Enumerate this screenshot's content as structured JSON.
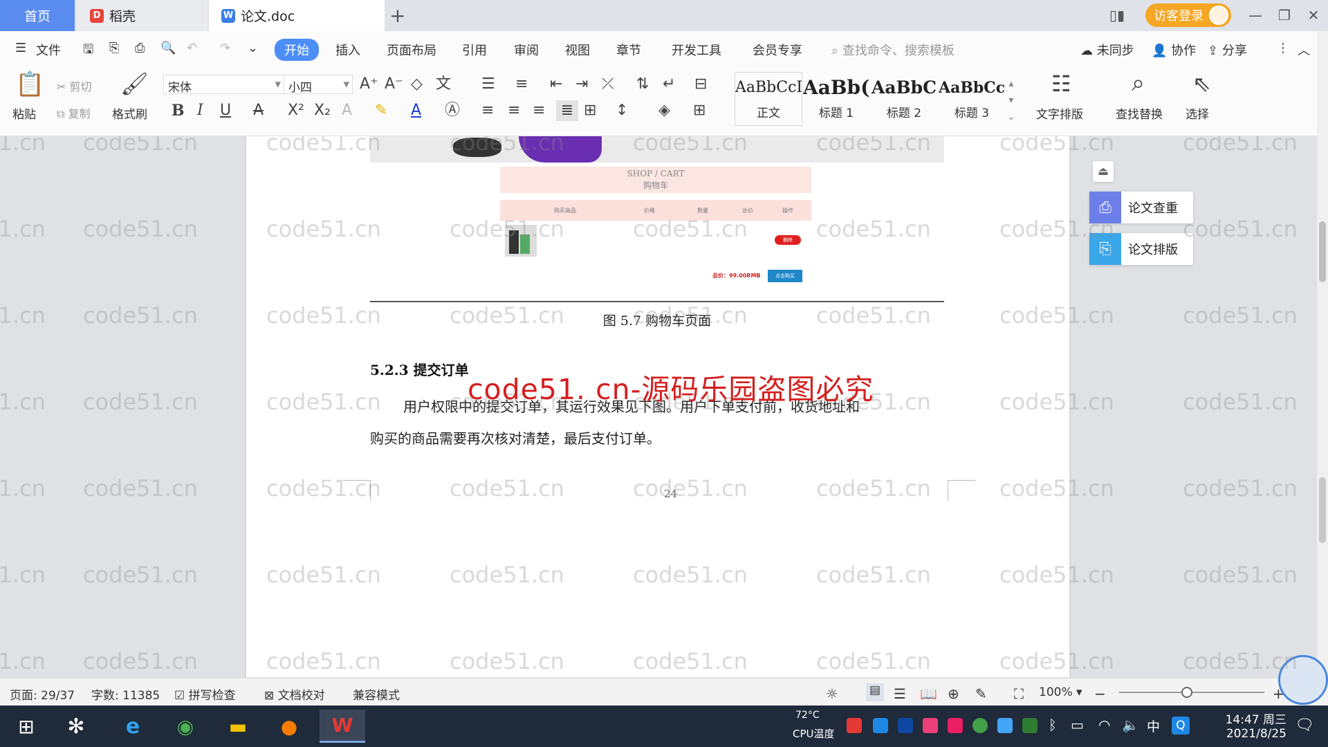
{
  "tabs": {
    "home": "首页",
    "daoke": "稻壳",
    "doc": "论文.doc"
  },
  "titlebar": {
    "visitor_login": "访客登录"
  },
  "menu": {
    "file": "文件",
    "items": [
      "开始",
      "插入",
      "页面布局",
      "引用",
      "审阅",
      "视图",
      "章节",
      "开发工具",
      "会员专享"
    ],
    "search_placeholder": "查找命令、搜索模板",
    "unsync": "未同步",
    "collab": "协作",
    "share": "分享"
  },
  "ribbon": {
    "paste": "粘贴",
    "cut": "剪切",
    "copy": "复制",
    "format_painter": "格式刷",
    "font_name": "宋体",
    "font_size": "小四",
    "styles": [
      {
        "preview": "AaBbCcI",
        "name": "正文"
      },
      {
        "preview": "AaBb(",
        "name": "标题 1"
      },
      {
        "preview": "AaBbC",
        "name": "标题 2"
      },
      {
        "preview": "AaBbCcl",
        "name": "标题 3"
      }
    ],
    "text_layout": "文字排版",
    "find_replace": "查找替换",
    "select": "选择"
  },
  "document": {
    "figure": {
      "shop_title_en": "SHOP / CART",
      "shop_title_cn": "购物车",
      "col_goods": "购买商品",
      "col_price": "价格",
      "col_qty": "数量",
      "col_total": "总价",
      "col_action": "操作",
      "delete_btn": "删除",
      "total_text": "总价：99.00RMB",
      "pay_btn": "点击购买"
    },
    "caption": "图 5.7  购物车页面",
    "heading": "5.2.3  提交订单",
    "paragraph_line1": "用户权限中的提交订单，其运行效果见下图。用户下单支付前，收货地址和",
    "paragraph_line2": "购买的商品需要再次核对清楚，最后支付订单。",
    "page_number": "24",
    "overlay_text": "code51. cn-源码乐园盗图必究"
  },
  "watermark_text": "code51.cn",
  "side_panel": {
    "check": "论文查重",
    "format": "论文排版"
  },
  "statusbar": {
    "page": "页面: 29/37",
    "words": "字数: 11385",
    "spell": "拼写检查",
    "proof": "文档校对",
    "compat": "兼容模式",
    "zoom": "100%"
  },
  "taskbar": {
    "temp": "72°C",
    "cpu": "CPU温度",
    "ime": "中",
    "time": "14:47 周三",
    "date": "2021/8/25"
  },
  "colors": {
    "accent": "#4c8df6",
    "home_tab": "#5b8df0",
    "visitor": "#f5a623",
    "overlay_red": "#d41e1e",
    "taskbar": "#1f2a3a"
  }
}
